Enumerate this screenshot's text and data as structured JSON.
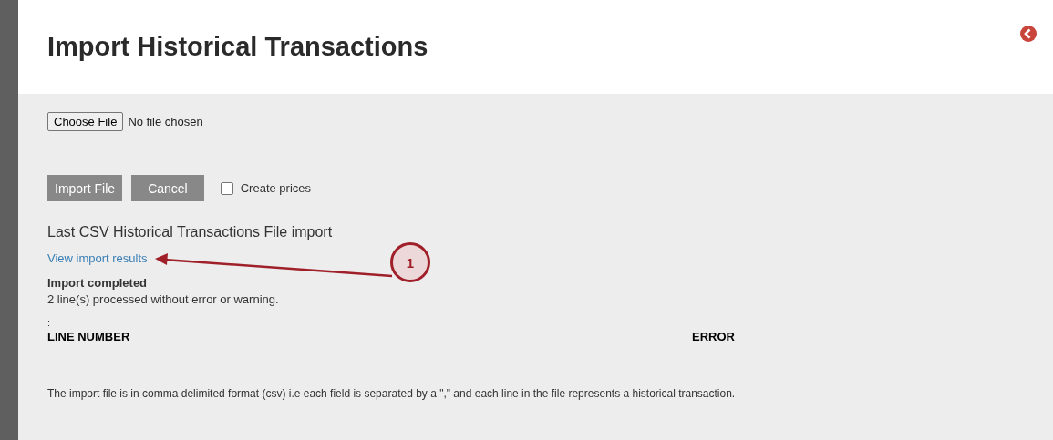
{
  "title": "Import Historical Transactions",
  "file_input": {
    "button": "Choose File",
    "status": "No file chosen"
  },
  "buttons": [
    {
      "label": "Import File"
    },
    {
      "label": "Cancel"
    }
  ],
  "create_prices": {
    "label": "Create prices",
    "checked": false
  },
  "last_import": {
    "heading": "Last CSV Historical Transactions File import",
    "link": "View import results",
    "status": "Import completed",
    "message": "2 line(s) processed without error or warning.",
    "separator": ":"
  },
  "table": {
    "columns": [
      "LINE NUMBER",
      "ERROR"
    ]
  },
  "note": "The import file is in comma delimited format (csv) i.e each field is separated by a \",\" and each line in the file represents a historical transaction.",
  "annotation": {
    "label": "1"
  }
}
